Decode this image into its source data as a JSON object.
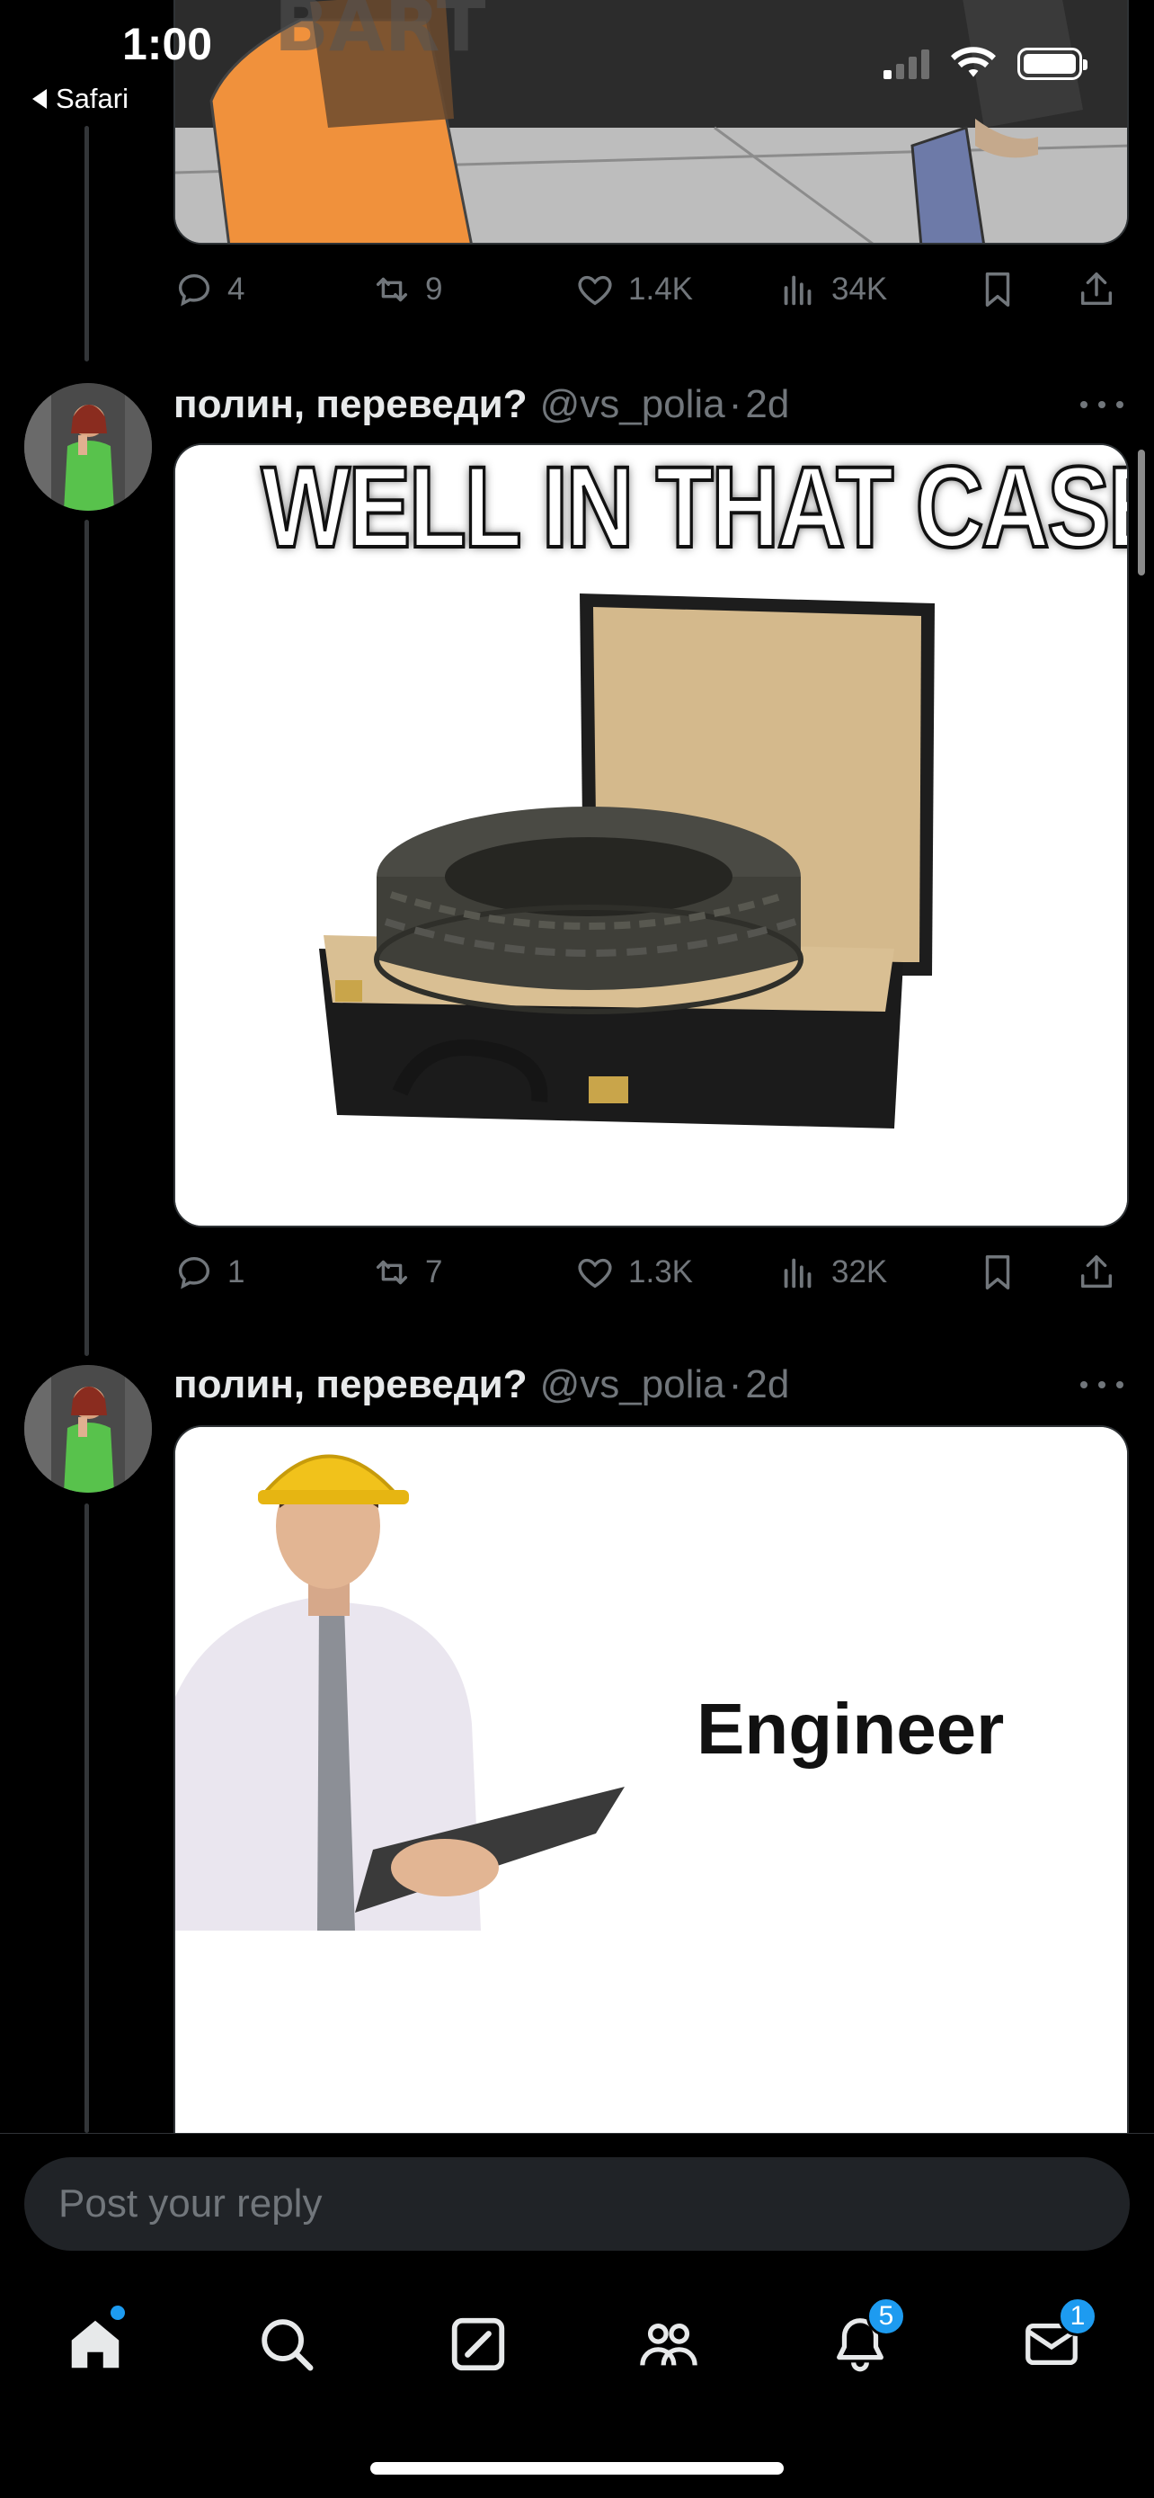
{
  "status_bar": {
    "time": "1:00",
    "back_label": "Safari"
  },
  "top_media": {
    "text": "BART",
    "actions": {
      "replies": "4",
      "reposts": "9",
      "likes": "1.4K",
      "views": "34K"
    }
  },
  "tweets": [
    {
      "display_name": "полин, переведи?",
      "handle": "@vs_polia",
      "separator": "·",
      "time_ago": "2d",
      "meme_caption": "WELL IN THAT CASE",
      "actions": {
        "replies": "1",
        "reposts": "7",
        "likes": "1.3K",
        "views": "32K"
      }
    },
    {
      "display_name": "полин, переведи?",
      "handle": "@vs_polia",
      "separator": "·",
      "time_ago": "2d",
      "meme_caption": "Engineer"
    }
  ],
  "reply_bar": {
    "placeholder": "Post your reply"
  },
  "tab_bar": {
    "items": [
      "home-icon",
      "search-icon",
      "compose-icon",
      "communities-icon",
      "notifications-icon",
      "messages-icon"
    ],
    "notifications_badge": "5",
    "messages_badge": "1"
  },
  "colors": {
    "background": "#000000",
    "text": "#e7e9ea",
    "muted": "#71767b",
    "accent": "#1d9bf0"
  }
}
